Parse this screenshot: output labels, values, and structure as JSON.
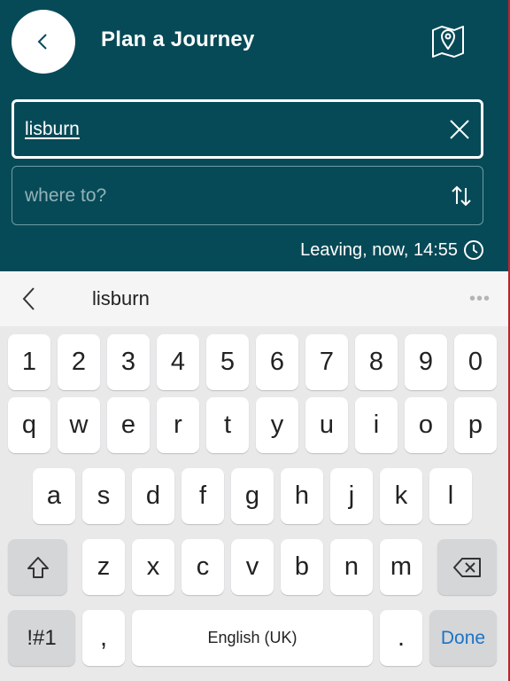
{
  "header": {
    "title": "Plan a Journey",
    "back_icon": "chevron-left-icon",
    "map_icon": "map-pin-icon"
  },
  "from_field": {
    "value": "lisburn",
    "clear_icon": "close-icon"
  },
  "to_field": {
    "placeholder": "where to?",
    "swap_icon": "swap-vertical-icon"
  },
  "leaving": {
    "text": "Leaving, now, 14:55",
    "icon": "clock-icon"
  },
  "suggestions": {
    "word": "lisburn",
    "more": "•••"
  },
  "keyboard": {
    "numbers": [
      "1",
      "2",
      "3",
      "4",
      "5",
      "6",
      "7",
      "8",
      "9",
      "0"
    ],
    "row1": [
      "q",
      "w",
      "e",
      "r",
      "t",
      "y",
      "u",
      "i",
      "o",
      "p"
    ],
    "row2": [
      "a",
      "s",
      "d",
      "f",
      "g",
      "h",
      "j",
      "k",
      "l"
    ],
    "row3": [
      "z",
      "x",
      "c",
      "v",
      "b",
      "n",
      "m"
    ],
    "symbols": "!#1",
    "comma": ",",
    "space": "English (UK)",
    "period": ".",
    "done": "Done"
  },
  "colors": {
    "header_bg": "#074a57",
    "accent": "#1a73c8",
    "keyboard_bg": "#e9e9ea"
  }
}
